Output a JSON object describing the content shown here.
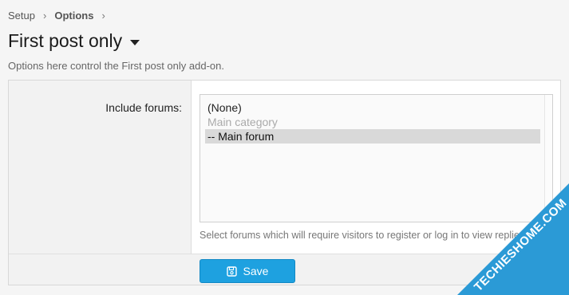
{
  "breadcrumb": {
    "items": [
      "Setup",
      "Options"
    ],
    "separator": "›"
  },
  "header": {
    "title": "First post only",
    "description": "Options here control the First post only add-on."
  },
  "form": {
    "field_label": "Include forums:",
    "options": [
      {
        "label": "(None)",
        "state": "normal"
      },
      {
        "label": "Main category",
        "state": "disabled"
      },
      {
        "label": "-- Main forum",
        "state": "selected"
      }
    ],
    "help_text": "Select forums which will require visitors to register or log in to view replies."
  },
  "footer": {
    "save_label": "Save"
  },
  "watermark": {
    "text": "TECHIESHOME.COM"
  },
  "colors": {
    "accent": "#1ea1e0",
    "watermark": "#2b9ad6"
  }
}
